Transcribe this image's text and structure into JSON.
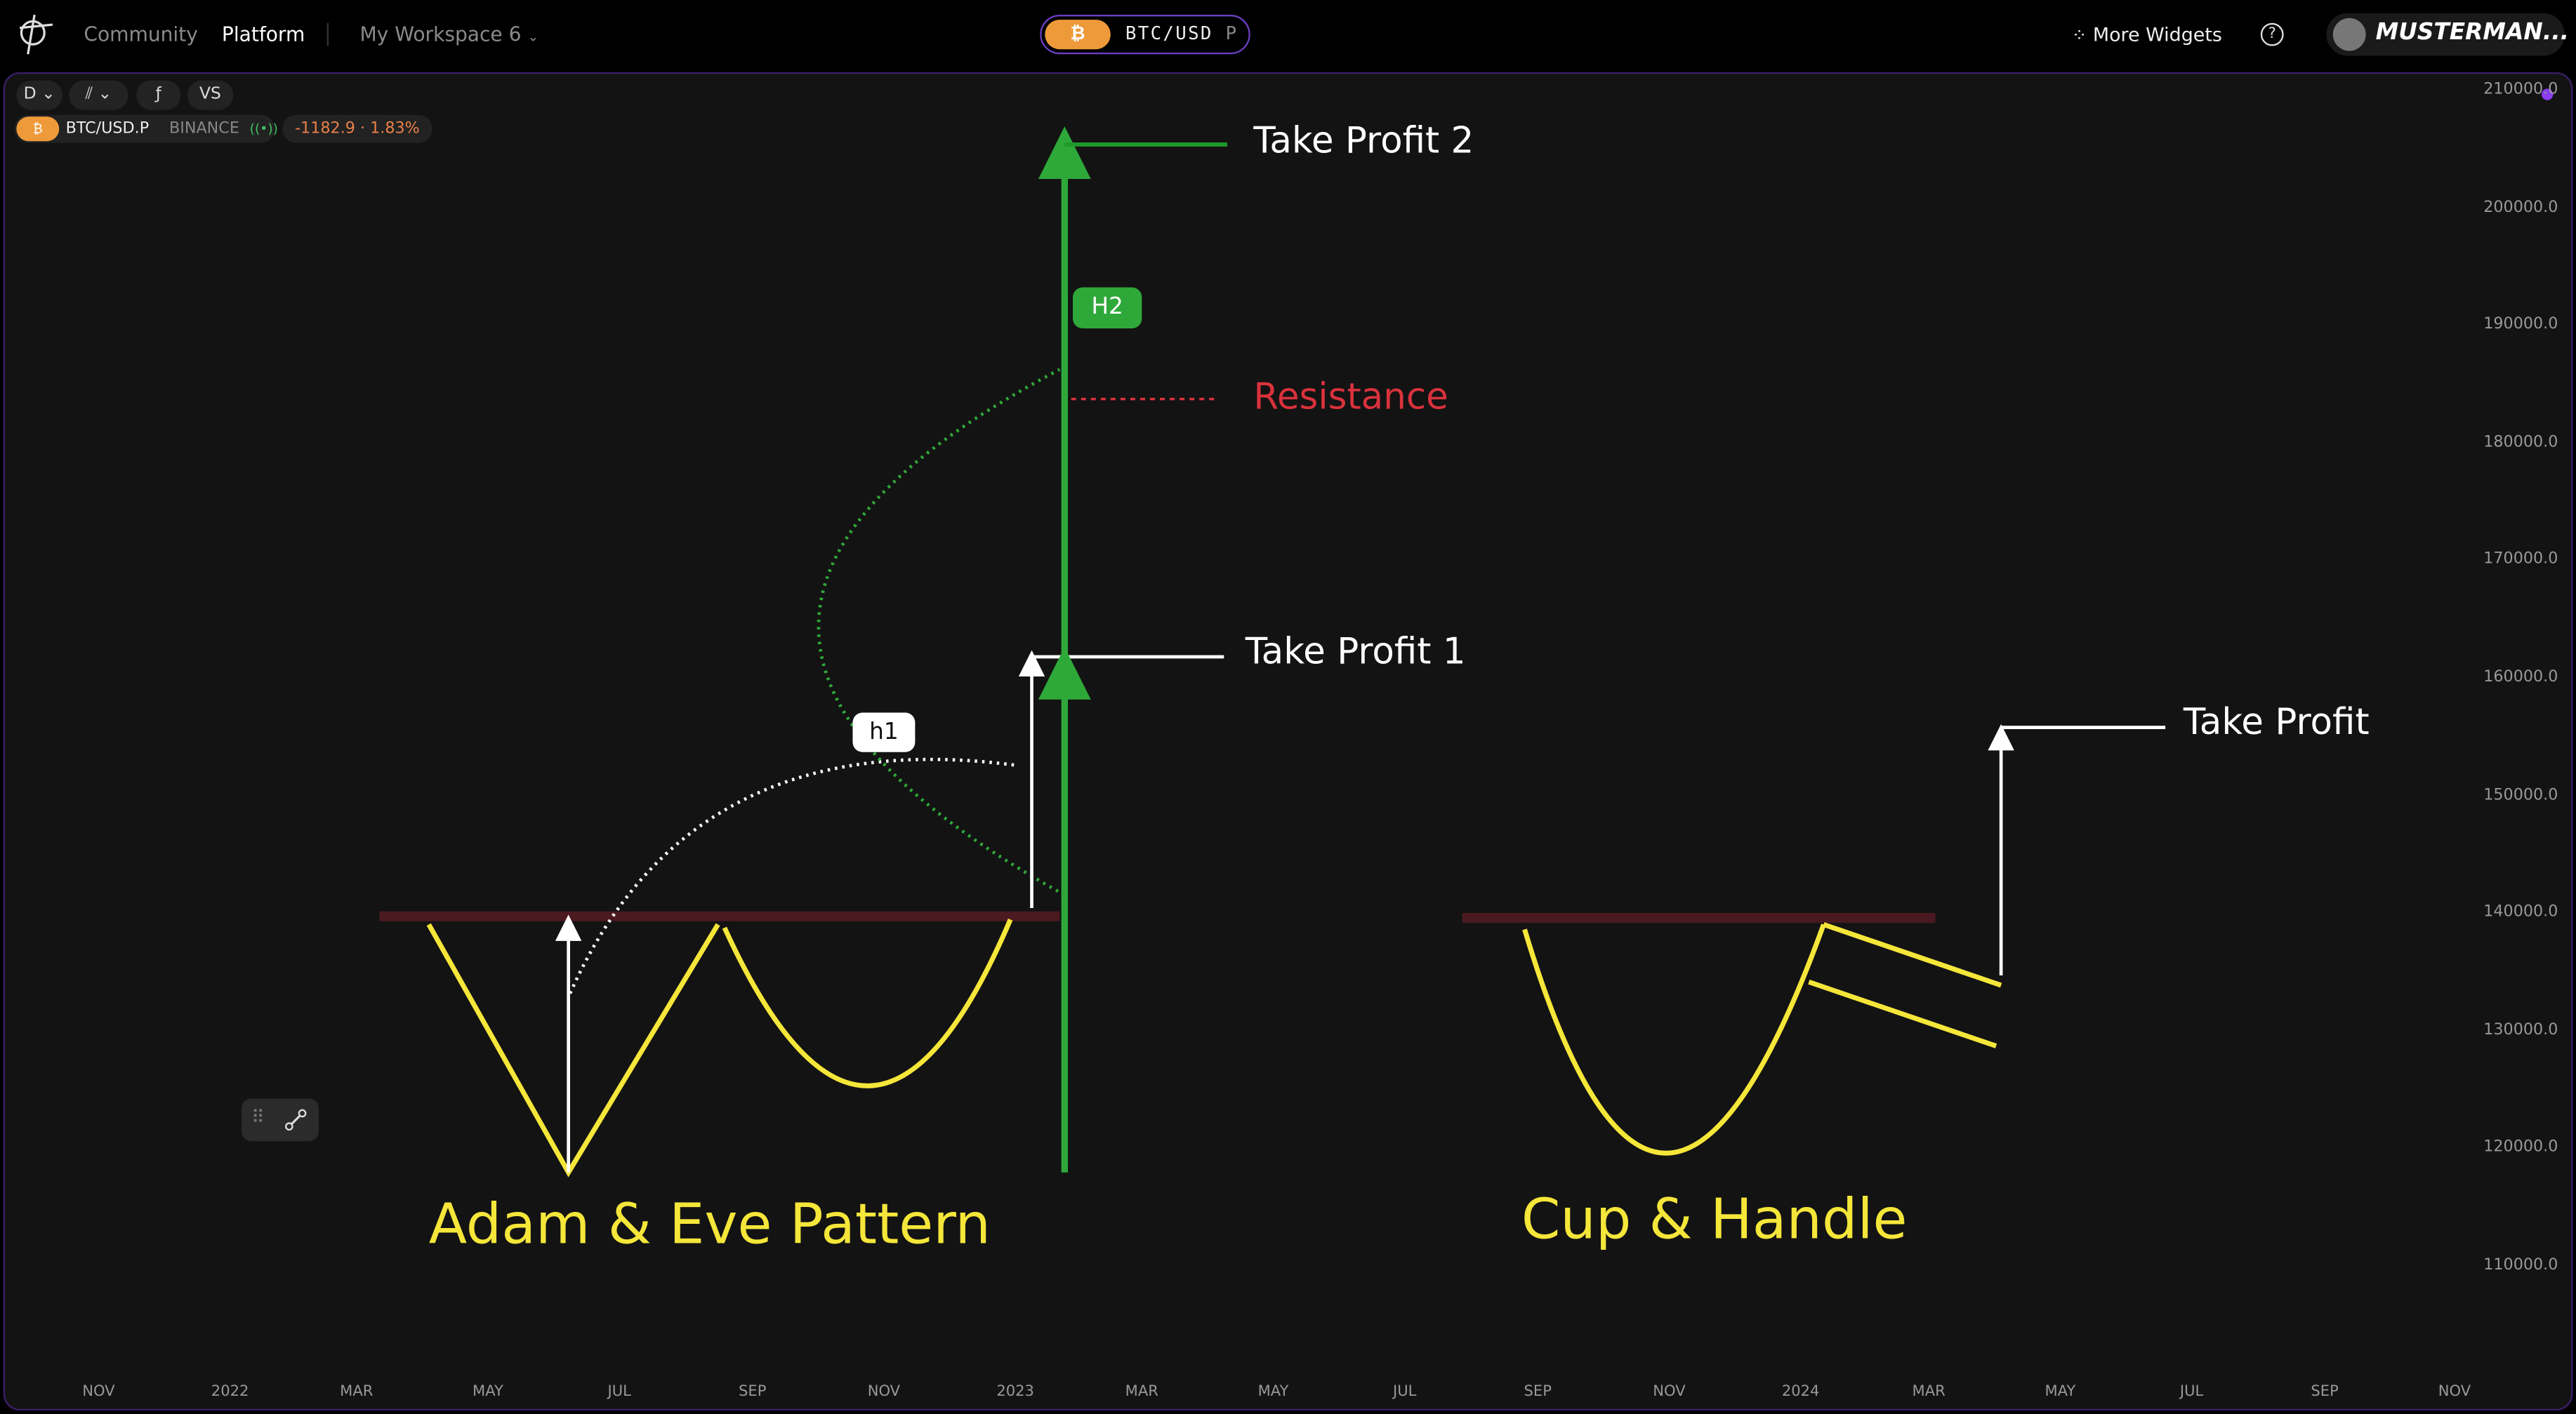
{
  "header": {
    "nav": [
      "Community",
      "Platform"
    ],
    "active_nav": "Platform",
    "workspace": "My Workspace 6",
    "symbol": "BTC/USD",
    "symbol_suffix": "P",
    "more_widgets": "More Widgets",
    "username": "MUSTERMAN..."
  },
  "toolbar": {
    "interval": "D",
    "vs": "VS"
  },
  "ticker": {
    "symbol": "BTC/USD.P",
    "exchange": "BINANCE",
    "change": "-1182.9 · 1.83%",
    "change_color": "#e8804a"
  },
  "colors": {
    "accent": "#6a3fc0",
    "bitcoin": "#ef9a3a",
    "pattern": "#f5e63a",
    "target": "#2fa83a",
    "resistance": "#d9323c"
  },
  "y_axis": [
    "210000.0",
    "200000.0",
    "190000.0",
    "180000.0",
    "170000.0",
    "160000.0",
    "150000.0",
    "140000.0",
    "130000.0",
    "120000.0",
    "110000.0"
  ],
  "x_axis": [
    "NOV",
    "2022",
    "MAR",
    "MAY",
    "JUL",
    "SEP",
    "NOV",
    "2023",
    "MAR",
    "MAY",
    "JUL",
    "SEP",
    "NOV",
    "2024",
    "MAR",
    "MAY",
    "JUL",
    "SEP",
    "NOV"
  ],
  "annotations": {
    "tp2": "Take Profit 2",
    "h2": "H2",
    "resistance": "Resistance",
    "tp1": "Take Profit 1",
    "h1": "h1",
    "tp": "Take Profit",
    "adam_eve": "Adam & Eve Pattern",
    "cup_handle": "Cup & Handle"
  }
}
